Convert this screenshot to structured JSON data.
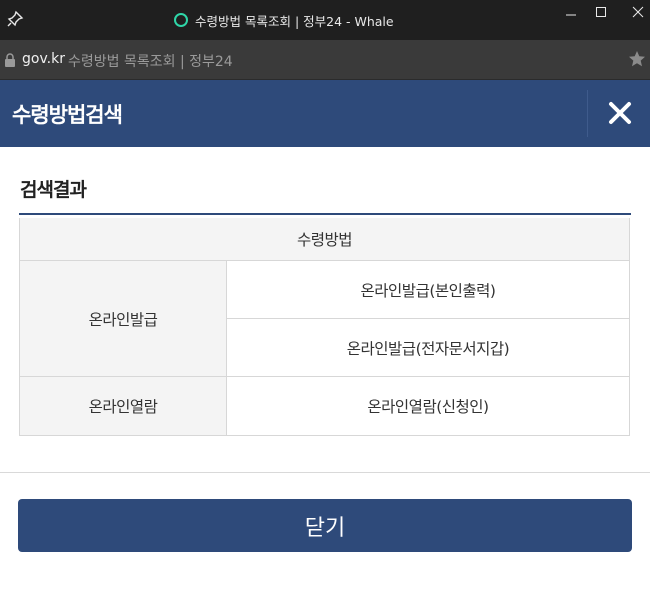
{
  "window": {
    "title": "수령방법 목록조회 | 정부24 - Whale"
  },
  "address_bar": {
    "domain": "gov.kr",
    "page_title": "수령방법 목록조회 | 정부24"
  },
  "modal": {
    "header_title": "수령방법검색",
    "section_title": "검색결과",
    "table": {
      "column_header": "수령방법",
      "groups": [
        {
          "label": "온라인발급",
          "methods": [
            "온라인발급(본인출력)",
            "온라인발급(전자문서지갑)"
          ]
        },
        {
          "label": "온라인열람",
          "methods": [
            "온라인열람(신청인)"
          ]
        }
      ]
    },
    "close_label": "닫기"
  },
  "colors": {
    "accent": "#2e4a7a",
    "cell_bg": "#f4f4f4",
    "titlebar": "#1f1f1f",
    "whale_ring": "#2fd6a8"
  },
  "icons": [
    "pin-icon",
    "whale-logo-icon",
    "minimize-icon",
    "maximize-icon",
    "window-close-icon",
    "lock-icon",
    "bookmark-star-icon",
    "close-icon"
  ]
}
